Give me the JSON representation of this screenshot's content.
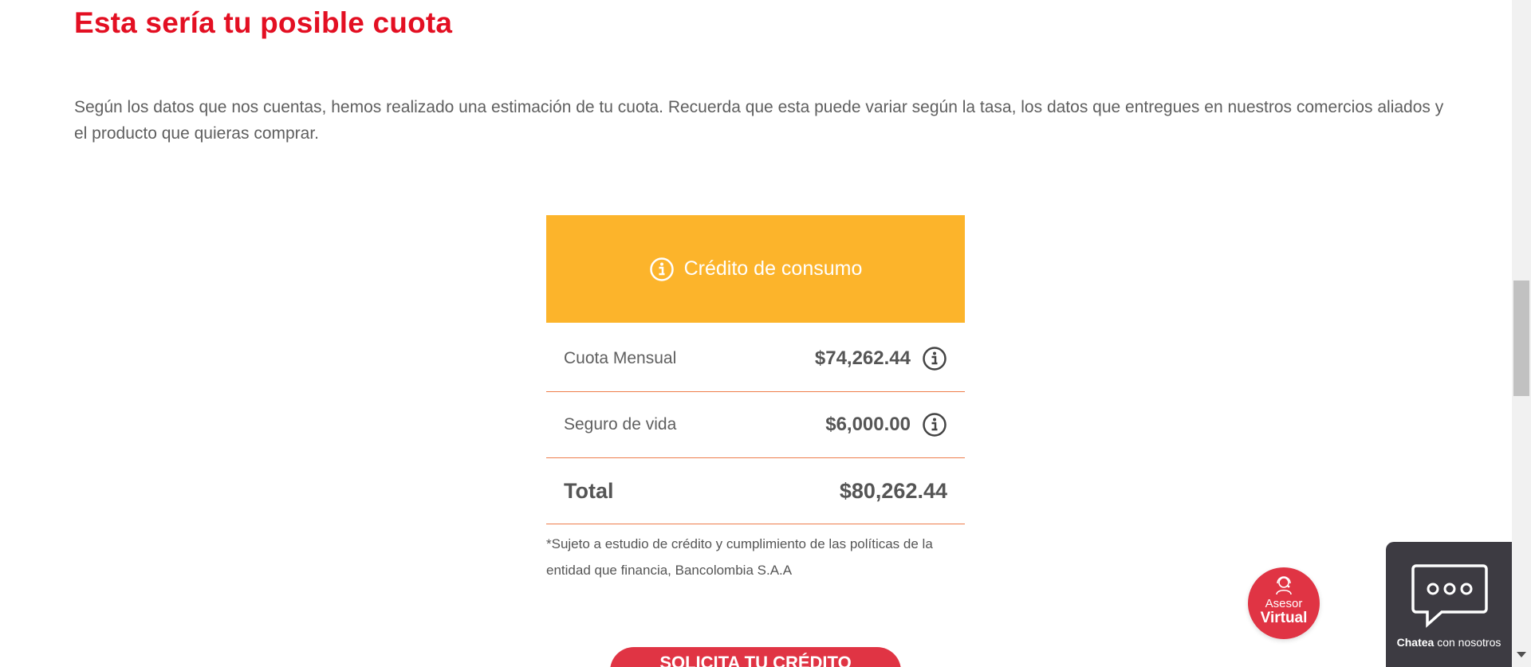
{
  "heading": "Esta sería tu posible cuota",
  "intro": "Según los datos que nos cuentas, hemos realizado una estimación de tu cuota. Recuerda que esta puede variar según la tasa, los datos que entregues en nuestros comercios aliados y el producto que quieras comprar.",
  "card": {
    "title": "Crédito de consumo",
    "header_icon": "info-icon",
    "header_color": "#fcb42b",
    "rows": [
      {
        "label": "Cuota Mensual",
        "amount": "$74,262.44",
        "icon": "info-icon"
      },
      {
        "label": "Seguro de vida",
        "amount": "$6,000.00",
        "icon": "info-icon"
      }
    ],
    "total": {
      "label": "Total",
      "amount": "$80,262.44"
    },
    "disclaimer": "*Sujeto a estudio de crédito y cumplimiento de las políticas de la entidad que financia, Bancolombia S.A.A"
  },
  "cta": {
    "label": "SOLICITA TU CRÉDITO"
  },
  "asesor": {
    "line1": "Asesor",
    "line2": "Virtual",
    "icon": "agent-icon"
  },
  "chat": {
    "label_bold": "Chatea",
    "label_rest": " con nosotros",
    "icon": "chat-bubble-icon"
  },
  "colors": {
    "accent": "#e30f22",
    "button": "#e03444",
    "divider": "#ee7d4b",
    "chat_bg": "#3d3b42"
  }
}
